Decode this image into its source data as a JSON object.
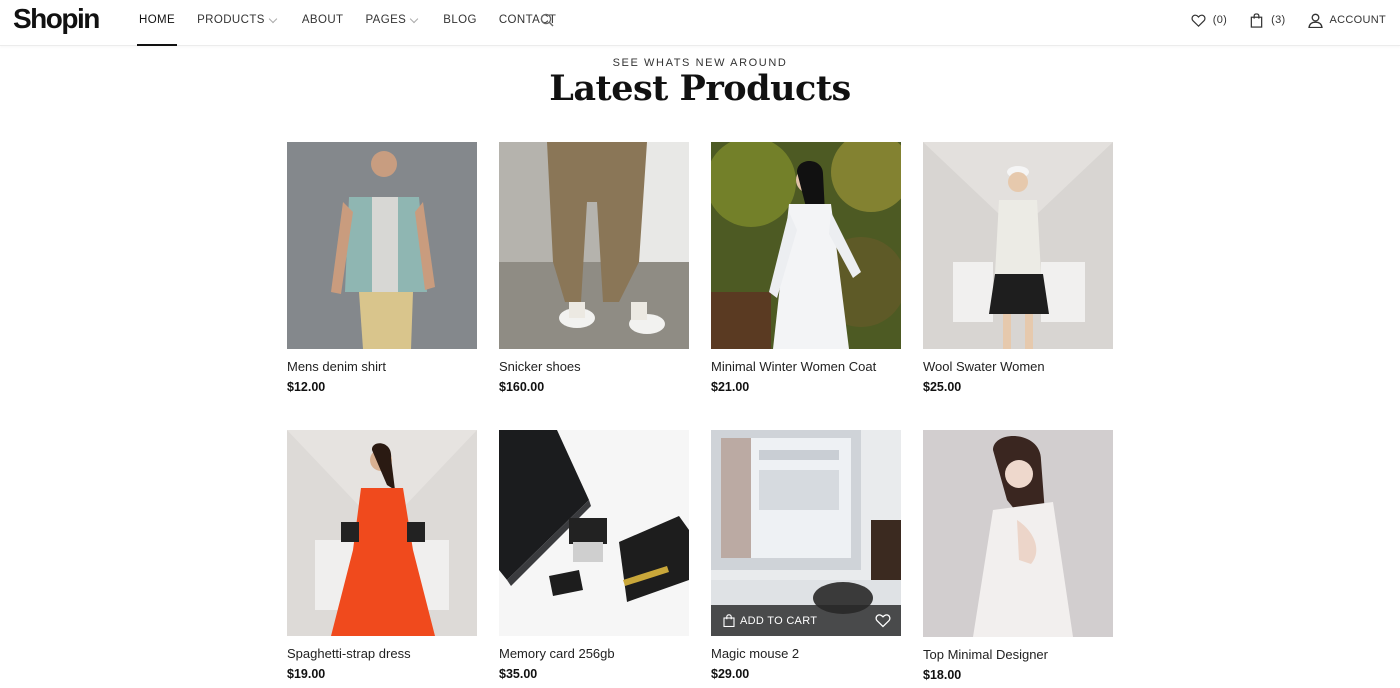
{
  "brand": {
    "logo_text": "Shopin"
  },
  "nav": {
    "items": [
      {
        "label": "HOME",
        "active": true,
        "dropdown": false
      },
      {
        "label": "PRODUCTS",
        "active": false,
        "dropdown": true
      },
      {
        "label": "ABOUT",
        "active": false,
        "dropdown": false
      },
      {
        "label": "PAGES",
        "active": false,
        "dropdown": true
      },
      {
        "label": "BLOG",
        "active": false,
        "dropdown": false
      },
      {
        "label": "CONTACT",
        "active": false,
        "dropdown": false
      }
    ],
    "search_icon": "search-icon"
  },
  "header_actions": {
    "wishlist_count": "(0)",
    "cart_count": "(3)",
    "account_label": "ACCOUNT"
  },
  "section": {
    "eyebrow": "SEE WHATS NEW AROUND",
    "title": "Latest Products"
  },
  "products": [
    {
      "name": "Mens denim shirt",
      "price": "$12.00"
    },
    {
      "name": "Snicker shoes",
      "price": "$160.00"
    },
    {
      "name": "Minimal Winter Women Coat",
      "price": "$21.00"
    },
    {
      "name": "Wool Swater Women",
      "price": "$25.00"
    },
    {
      "name": "Spaghetti-strap dress",
      "price": "$19.00"
    },
    {
      "name": "Memory card 256gb",
      "price": "$35.00"
    },
    {
      "name": "Magic mouse 2",
      "price": "$29.00"
    },
    {
      "name": "Top Minimal Designer",
      "price": "$18.00"
    }
  ],
  "hover_overlay": {
    "add_to_cart_label": "ADD TO CART"
  },
  "colors": {
    "text": "#222222",
    "accent": "#111111",
    "overlay": "#2b2b2b",
    "background": "#ffffff"
  }
}
